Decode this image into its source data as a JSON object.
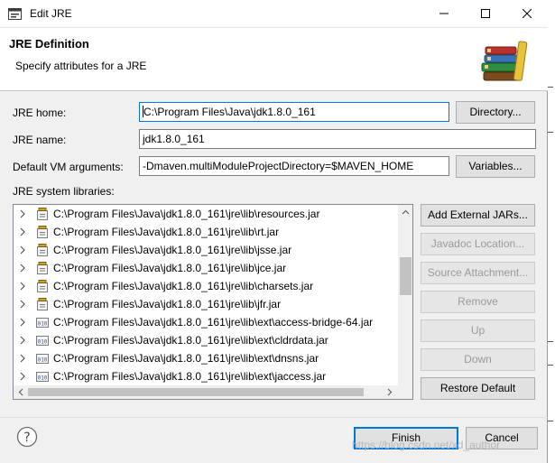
{
  "window": {
    "title": "Edit JRE"
  },
  "header": {
    "title": "JRE Definition",
    "subtitle": "Specify attributes for a JRE",
    "icon": "books-icon"
  },
  "form": {
    "jre_home": {
      "label": "JRE home:",
      "value": "C:\\Program Files\\Java\\jdk1.8.0_161",
      "button": "Directory..."
    },
    "jre_name": {
      "label": "JRE name:",
      "value": "jdk1.8.0_161"
    },
    "vm_args": {
      "label": "Default VM arguments:",
      "value": "-Dmaven.multiModuleProjectDirectory=$MAVEN_HOME",
      "button": "Variables..."
    }
  },
  "libraries": {
    "label": "JRE system libraries:",
    "items": [
      {
        "path": "C:\\Program Files\\Java\\jdk1.8.0_161\\jre\\lib\\resources.jar",
        "icon": "jar-icon"
      },
      {
        "path": "C:\\Program Files\\Java\\jdk1.8.0_161\\jre\\lib\\rt.jar",
        "icon": "jar-icon"
      },
      {
        "path": "C:\\Program Files\\Java\\jdk1.8.0_161\\jre\\lib\\jsse.jar",
        "icon": "jar-icon"
      },
      {
        "path": "C:\\Program Files\\Java\\jdk1.8.0_161\\jre\\lib\\jce.jar",
        "icon": "jar-icon"
      },
      {
        "path": "C:\\Program Files\\Java\\jdk1.8.0_161\\jre\\lib\\charsets.jar",
        "icon": "jar-icon"
      },
      {
        "path": "C:\\Program Files\\Java\\jdk1.8.0_161\\jre\\lib\\jfr.jar",
        "icon": "jar-icon"
      },
      {
        "path": "C:\\Program Files\\Java\\jdk1.8.0_161\\jre\\lib\\ext\\access-bridge-64.jar",
        "icon": "binary-jar-icon"
      },
      {
        "path": "C:\\Program Files\\Java\\jdk1.8.0_161\\jre\\lib\\ext\\cldrdata.jar",
        "icon": "binary-jar-icon"
      },
      {
        "path": "C:\\Program Files\\Java\\jdk1.8.0_161\\jre\\lib\\ext\\dnsns.jar",
        "icon": "binary-jar-icon"
      },
      {
        "path": "C:\\Program Files\\Java\\jdk1.8.0_161\\jre\\lib\\ext\\jaccess.jar",
        "icon": "binary-jar-icon"
      }
    ],
    "buttons": {
      "add_external": "Add External JARs...",
      "javadoc": "Javadoc Location...",
      "source": "Source Attachment...",
      "remove": "Remove",
      "up": "Up",
      "down": "Down",
      "restore": "Restore Default"
    }
  },
  "footer": {
    "finish": "Finish",
    "cancel": "Cancel",
    "watermark": "https://blog.csdn.net/xd_author"
  },
  "colors": {
    "focus": "#0078d7",
    "button_face": "#e1e1e1",
    "dialog_bg": "#f0f0f0"
  }
}
